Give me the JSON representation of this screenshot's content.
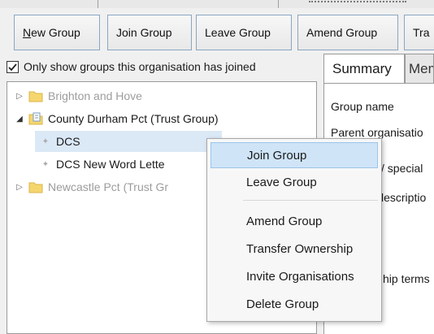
{
  "toolbar": {
    "buttons": [
      {
        "label": "New Group",
        "mnemonic": "N",
        "rest": "ew Group"
      },
      {
        "label": "Join Group"
      },
      {
        "label": "Leave Group"
      },
      {
        "label": "Amend Group"
      },
      {
        "label": "Tra"
      }
    ]
  },
  "filter": {
    "checkbox_label": "Only show groups this organisation has joined",
    "checked": true
  },
  "tree": {
    "nodes": [
      {
        "label": "Brighton and Hove",
        "expanded": false
      },
      {
        "label": "County Durham Pct (Trust Group)",
        "expanded": true
      },
      {
        "label": "DCS"
      },
      {
        "label": "DCS New Word Lette"
      },
      {
        "label": "Newcastle Pct (Trust Gr",
        "expanded": false
      }
    ]
  },
  "details": {
    "tabs": [
      {
        "label": "Summary"
      },
      {
        "label": "Mem"
      }
    ],
    "fields": [
      {
        "label": "Group name"
      },
      {
        "label": "Parent organisatio"
      },
      {
        "label": "/ special"
      },
      {
        "label": "lescriptio"
      },
      {
        "label": "hip terms"
      }
    ]
  },
  "context_menu": {
    "items": [
      {
        "label": "Join Group",
        "highlighted": true
      },
      {
        "label": "Leave Group"
      },
      {
        "label": "Amend Group"
      },
      {
        "label": "Transfer Ownership"
      },
      {
        "label": "Invite Organisations"
      },
      {
        "label": "Delete Group"
      }
    ]
  },
  "colors": {
    "menu_highlight": "#cfe4f7",
    "folder_yellow": "#f5d66e",
    "selection": "#dbe8f6"
  }
}
